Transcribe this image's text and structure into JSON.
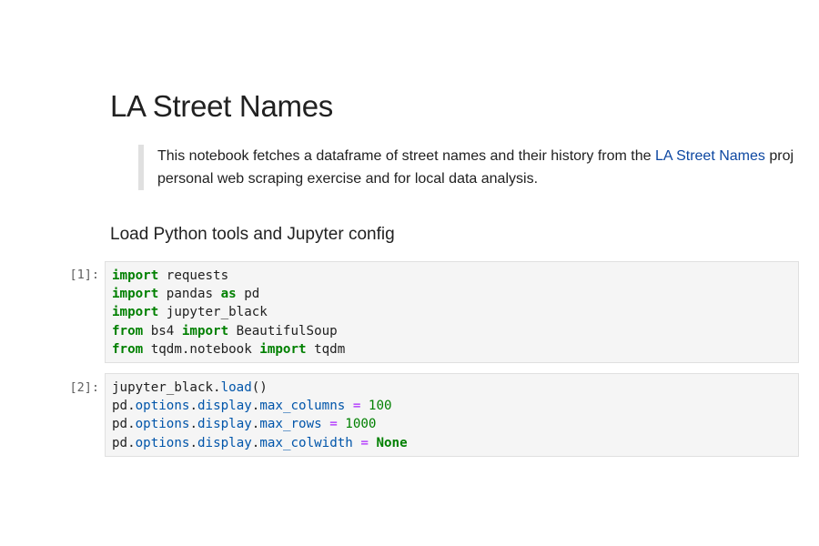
{
  "title": "LA Street Names",
  "intro": {
    "line1_before": "This notebook fetches a dataframe of street names and their history from the ",
    "link_text": "LA Street Names",
    "line1_after": " proj",
    "line2": "personal web scraping exercise and for local data analysis."
  },
  "section_heading": "Load Python tools and Jupyter config",
  "cells": [
    {
      "prompt": "[1]:",
      "lines": [
        {
          "k1": "import",
          "t1": " requests"
        },
        {
          "k1": "import",
          "t1": " pandas ",
          "k2": "as",
          "t2": " pd"
        },
        {
          "k1": "import",
          "t1": " jupyter_black"
        },
        {
          "k1": "from",
          "t1": " bs4 ",
          "k2": "import",
          "t2": " BeautifulSoup"
        },
        {
          "k1": "from",
          "t1": " tqdm.notebook ",
          "k2": "import",
          "t2": " tqdm"
        }
      ]
    },
    {
      "prompt": "[2]:",
      "lines": [
        {
          "obj": "jupyter_black",
          "dot1": ".",
          "attr1": "load",
          "rest": "()"
        },
        {
          "obj": "pd",
          "dot1": ".",
          "attr1": "options",
          "dot2": ".",
          "attr2": "display",
          "dot3": ".",
          "attr3": "max_columns",
          "eq": " = ",
          "val": "100"
        },
        {
          "obj": "pd",
          "dot1": ".",
          "attr1": "options",
          "dot2": ".",
          "attr2": "display",
          "dot3": ".",
          "attr3": "max_rows",
          "eq": " = ",
          "val": "1000"
        },
        {
          "obj": "pd",
          "dot1": ".",
          "attr1": "options",
          "dot2": ".",
          "attr2": "display",
          "dot3": ".",
          "attr3": "max_colwidth",
          "eq": " = ",
          "valkw": "None"
        }
      ]
    }
  ]
}
